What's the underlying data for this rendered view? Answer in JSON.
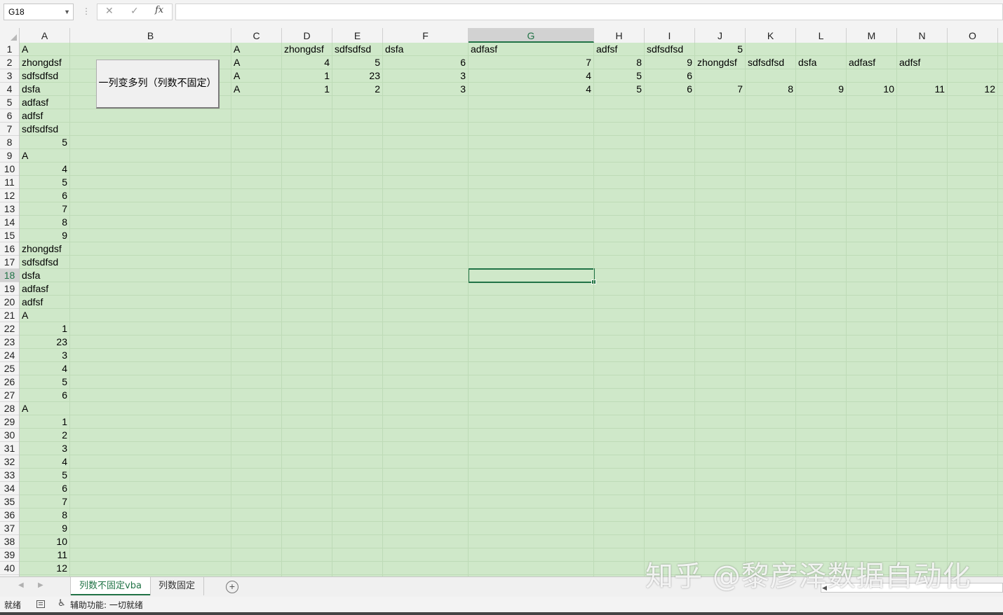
{
  "formula_bar": {
    "name_box": "G18",
    "cancel_icon": "✕",
    "enter_icon": "✓",
    "fx_label": "fx",
    "formula": ""
  },
  "columns": [
    "A",
    "B",
    "C",
    "D",
    "E",
    "F",
    "G",
    "H",
    "I",
    "J",
    "K",
    "L",
    "M",
    "N",
    "O"
  ],
  "selected_column": "G",
  "selected_row": 18,
  "rows": [
    "1",
    "2",
    "3",
    "4",
    "5",
    "6",
    "7",
    "8",
    "9",
    "10",
    "11",
    "12",
    "13",
    "14",
    "15",
    "16",
    "17",
    "18",
    "19",
    "20",
    "21",
    "22",
    "23",
    "24",
    "25",
    "26",
    "27",
    "28",
    "29",
    "30",
    "31",
    "32",
    "33",
    "34",
    "35",
    "36",
    "37",
    "38",
    "39",
    "40"
  ],
  "cells": {
    "A": [
      "A",
      "zhongdsf",
      "sdfsdfsd",
      "dsfa",
      "adfasf",
      "adfsf",
      "sdfsdfsd",
      "5",
      "A",
      "4",
      "5",
      "6",
      "7",
      "8",
      "9",
      "zhongdsf",
      "sdfsdfsd",
      "dsfa",
      "adfasf",
      "adfsf",
      "A",
      "1",
      "23",
      "3",
      "4",
      "5",
      "6",
      "A",
      "1",
      "2",
      "3",
      "4",
      "5",
      "6",
      "7",
      "8",
      "9",
      "10",
      "11",
      "12"
    ],
    "C": [
      "A",
      "A",
      "A",
      "A"
    ],
    "D": [
      "zhongdsf",
      "4",
      "1",
      "1"
    ],
    "E": [
      "sdfsdfsd",
      "5",
      "23",
      "2"
    ],
    "F": [
      "dsfa",
      "6",
      "3",
      "3"
    ],
    "G": [
      "adfasf",
      "7",
      "4",
      "4"
    ],
    "H": [
      "adfsf",
      "8",
      "5",
      "5"
    ],
    "I": [
      "sdfsdfsd",
      "9",
      "6",
      "6"
    ],
    "J": [
      "5",
      "zhongdsf",
      "",
      "7"
    ],
    "K": [
      "",
      "sdfsdfsd",
      "",
      "8"
    ],
    "L": [
      "",
      "dsfa",
      "",
      "9"
    ],
    "M": [
      "",
      "adfasf",
      "",
      "10"
    ],
    "N": [
      "",
      "adfsf",
      "",
      "11"
    ],
    "O": [
      "",
      "",
      "",
      "12"
    ]
  },
  "macro_button": {
    "label": "一列变多列（列数不固定）"
  },
  "sheet_tabs": [
    {
      "label": "列数不固定vba",
      "active": true
    },
    {
      "label": "列数固定",
      "active": false
    }
  ],
  "add_sheet_icon": "+",
  "status": {
    "ready": "就绪",
    "accessibility": "辅助功能: 一切就绪"
  },
  "watermark": "知乎 @黎彦泽数据自动化",
  "colors": {
    "grid_fill": "#cfe8c9",
    "accent": "#217346"
  }
}
